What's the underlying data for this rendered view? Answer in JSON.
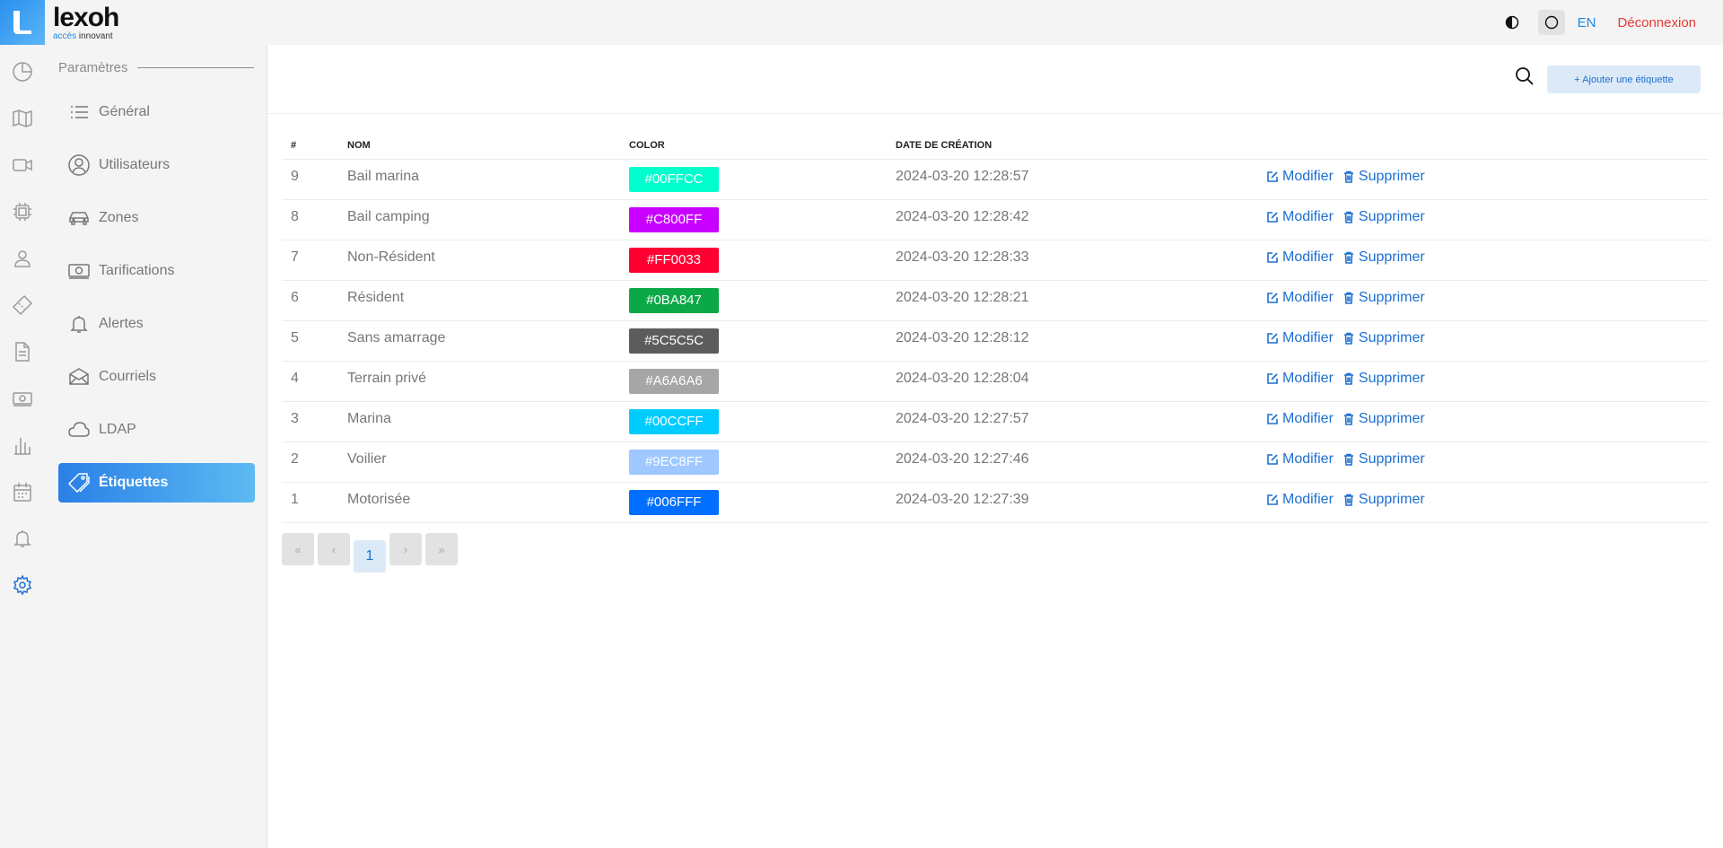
{
  "brand": {
    "name": "lexoh",
    "tag_accent": "accès",
    "tag_rest": " innovant"
  },
  "header": {
    "lang": "EN",
    "logout": "Déconnexion"
  },
  "rail": [
    {
      "icon": "pie-chart-icon"
    },
    {
      "icon": "map-icon"
    },
    {
      "icon": "video-camera-icon"
    },
    {
      "icon": "chip-icon"
    },
    {
      "icon": "user-icon"
    },
    {
      "icon": "ticket-icon"
    },
    {
      "icon": "document-icon"
    },
    {
      "icon": "money-icon"
    },
    {
      "icon": "bar-chart-icon"
    },
    {
      "icon": "calendar-icon"
    },
    {
      "icon": "bell-icon"
    },
    {
      "icon": "gear-icon"
    }
  ],
  "settings": {
    "title": "Paramètres",
    "items": [
      {
        "label": "Général",
        "icon": "list-icon"
      },
      {
        "label": "Utilisateurs",
        "icon": "user-circle-icon"
      },
      {
        "label": "Zones",
        "icon": "car-icon"
      },
      {
        "label": "Tarifications",
        "icon": "money-icon"
      },
      {
        "label": "Alertes",
        "icon": "bell-icon"
      },
      {
        "label": "Courriels",
        "icon": "envelope-icon"
      },
      {
        "label": "LDAP",
        "icon": "cloud-icon"
      },
      {
        "label": "Étiquettes",
        "icon": "tags-icon"
      }
    ]
  },
  "toolbar": {
    "add_label": "+ Ajouter une étiquette"
  },
  "table": {
    "headers": {
      "num": "#",
      "nom": "NOM",
      "color": "COLOR",
      "date": "DATE DE CRÉATION"
    },
    "edit_label": "Modifier",
    "delete_label": "Supprimer",
    "rows": [
      {
        "num": "9",
        "nom": "Bail marina",
        "color": "#00FFCC",
        "date": "2024-03-20 12:28:57"
      },
      {
        "num": "8",
        "nom": "Bail camping",
        "color": "#C800FF",
        "date": "2024-03-20 12:28:42"
      },
      {
        "num": "7",
        "nom": "Non-Résident",
        "color": "#FF0033",
        "date": "2024-03-20 12:28:33"
      },
      {
        "num": "6",
        "nom": "Résident",
        "color": "#0BA847",
        "date": "2024-03-20 12:28:21"
      },
      {
        "num": "5",
        "nom": "Sans amarrage",
        "color": "#5C5C5C",
        "date": "2024-03-20 12:28:12"
      },
      {
        "num": "4",
        "nom": "Terrain privé",
        "color": "#A6A6A6",
        "date": "2024-03-20 12:28:04"
      },
      {
        "num": "3",
        "nom": "Marina",
        "color": "#00CCFF",
        "date": "2024-03-20 12:27:57"
      },
      {
        "num": "2",
        "nom": "Voilier",
        "color": "#9EC8FF",
        "date": "2024-03-20 12:27:46"
      },
      {
        "num": "1",
        "nom": "Motorisée",
        "color": "#006FFF",
        "date": "2024-03-20 12:27:39"
      }
    ]
  },
  "pager": {
    "first": "«",
    "prev": "‹",
    "current": "1",
    "next": "›",
    "last": "»"
  },
  "colors": {
    "accent": "#1e6fd0",
    "logout": "#e53935"
  }
}
